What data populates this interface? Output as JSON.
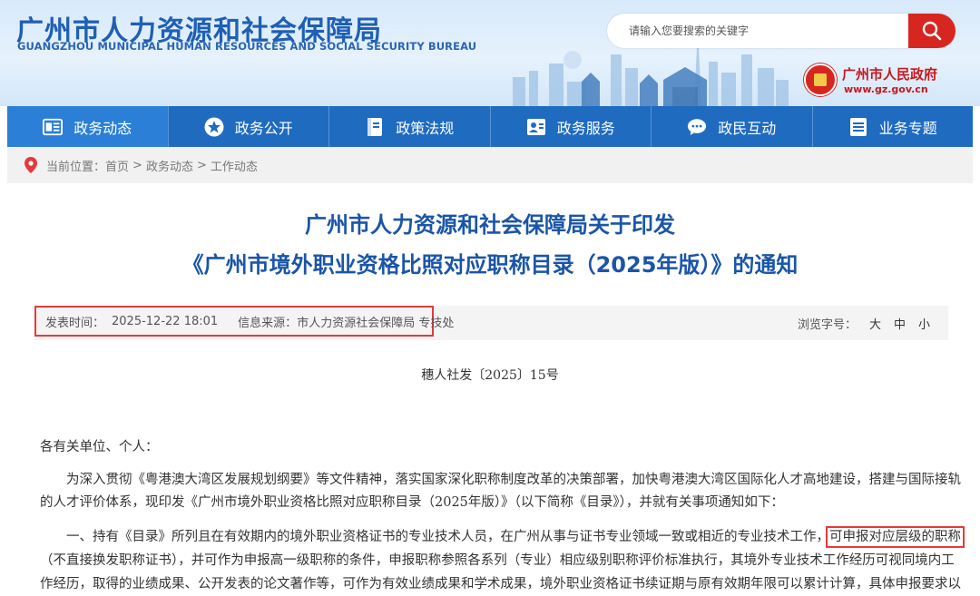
{
  "header": {
    "logo_cn": "广州市人力资源和社会保障局",
    "logo_en": "GUANGZHOU MUNICIPAL HUMAN RESOURCES AND SOCIAL SECURITY BUREAU",
    "gov_name": "广州市人民政府",
    "gov_url": "www.gz.gov.cn"
  },
  "search": {
    "placeholder": "请输入您要搜索的关键字"
  },
  "nav": [
    {
      "label": "政务动态",
      "icon": "news-icon"
    },
    {
      "label": "政务公开",
      "icon": "star-icon"
    },
    {
      "label": "政策法规",
      "icon": "book-icon"
    },
    {
      "label": "政务服务",
      "icon": "user-card-icon"
    },
    {
      "label": "政民互动",
      "icon": "chat-icon"
    },
    {
      "label": "业务专题",
      "icon": "list-icon"
    }
  ],
  "breadcrumb": {
    "prefix": "当前位置：",
    "items": [
      "首页",
      "政务动态",
      "工作动态"
    ],
    "sep": ">"
  },
  "article": {
    "title_line1": "广州市人力资源和社会保障局关于印发",
    "title_line2": "《广州市境外职业资格比照对应职称目录（2025年版）》的通知",
    "publish_label": "发表时间：",
    "publish_time": "2025-12-22 18:01",
    "source_label": "信息来源：",
    "source": "市人力资源社会保障局 专技处",
    "font_label": "浏览字号：",
    "font_sizes": [
      "大",
      "中",
      "小"
    ],
    "doc_number": "穗人社发〔2025〕15号",
    "salutation": "各有关单位、个人：",
    "p1_line1": "为深入贯彻《粤港澳大湾区发展规划纲要》等文件精神，落实国家深化职称制度改革的决策部署，加快粤港澳大湾区国际化人才高地建设，搭建与国际接轨",
    "p1_line2": "的人才评价体系，现印发《广州市境外职业资格比照对应职称目录（2025年版）》（以下简称《目录》），并就有关事项通知如下：",
    "p2_line1_a": "一、持有《目录》所列且在有效期内的境外职业资格证书的专业技术人员，在广州从事与证书专业领域一致或相近的专业技术工作，",
    "p2_line1_b": "可申报对应层级的职称",
    "p2_line2": "（不直接换发职称证书），并可作为申报高一级职称的条件，申报职称参照各系列（专业）相应级别职称评价标准执行，其境外专业技术工作经历可视同境内工",
    "p2_line3": "作经历，取得的业绩成果、公开发表的论文著作等，可作为有效业绩成果和学术成果，境外职业资格证书续证期与原有效期年限可以累计计算，具体申报要求以"
  }
}
